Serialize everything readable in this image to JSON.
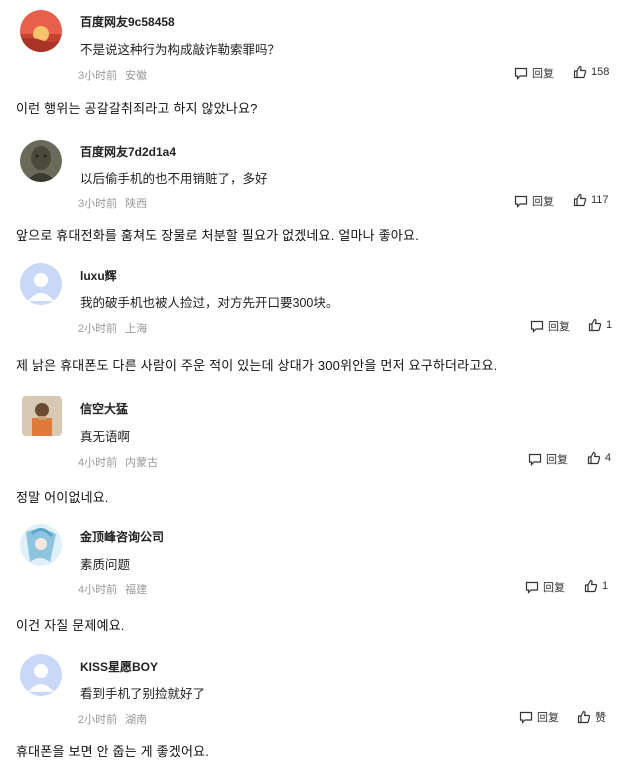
{
  "reply_label": "回复",
  "comments": [
    {
      "username": "百度网友9c58458",
      "text": "不是说这种行为构成敲诈勒索罪吗？",
      "time": "3小时前",
      "location": "安徽",
      "likes": "158",
      "translation": "이런 행위는 공갈갈취죄라고 하지 않았나요?"
    },
    {
      "username": "百度网友7d2d1a4",
      "text": "以后偷手机的也不用销赃了，多好",
      "time": "3小时前",
      "location": "陕西",
      "likes": "117",
      "translation": "앞으로 휴대전화를 훔쳐도 장물로 처분할 필요가 없겠네요. 얼마나 좋아요."
    },
    {
      "username": "luxu辉",
      "text": "我的破手机也被人捡过，对方先开口要300块。",
      "time": "2小时前",
      "location": "上海",
      "likes": "1",
      "translation": "제 낡은 휴대폰도 다른 사람이 주운 적이 있는데 상대가 300위안을 먼저 요구하더라고요."
    },
    {
      "username": "信空大猛",
      "text": "真无语啊",
      "time": "4小时前",
      "location": "内蒙古",
      "likes": "4",
      "translation": "정말 어이없네요."
    },
    {
      "username": "金顶峰咨询公司",
      "text": "素质问题",
      "time": "4小时前",
      "location": "福建",
      "likes": "1",
      "translation": "이건 자질 문제예요."
    },
    {
      "username": "KISS星愿BOY",
      "text": "看到手机了别捡就好了",
      "time": "2小时前",
      "location": "湖南",
      "likes": "赞",
      "translation": "휴대폰을 보면 안 줍는 게 좋겠어요."
    }
  ]
}
